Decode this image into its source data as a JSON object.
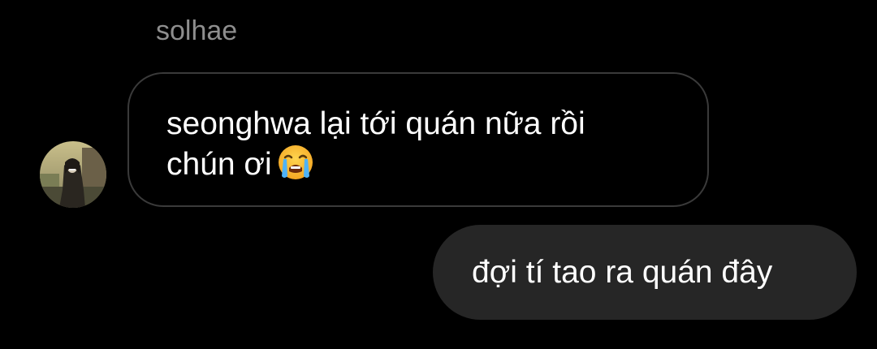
{
  "thread": {
    "sender_name": "solhae"
  },
  "messages": [
    {
      "direction": "incoming",
      "line1": "seonghwa lại tới quán nữa rồi",
      "line2": "chún ơi",
      "emoji": "loudly-crying-face"
    },
    {
      "direction": "outgoing",
      "text": "đợi tí tao ra quán đây"
    }
  ],
  "colors": {
    "background": "#000000",
    "incoming_border": "#3a3a3a",
    "outgoing_bubble": "#262626",
    "sender_name": "#8e8e8e",
    "text": "#ffffff"
  }
}
